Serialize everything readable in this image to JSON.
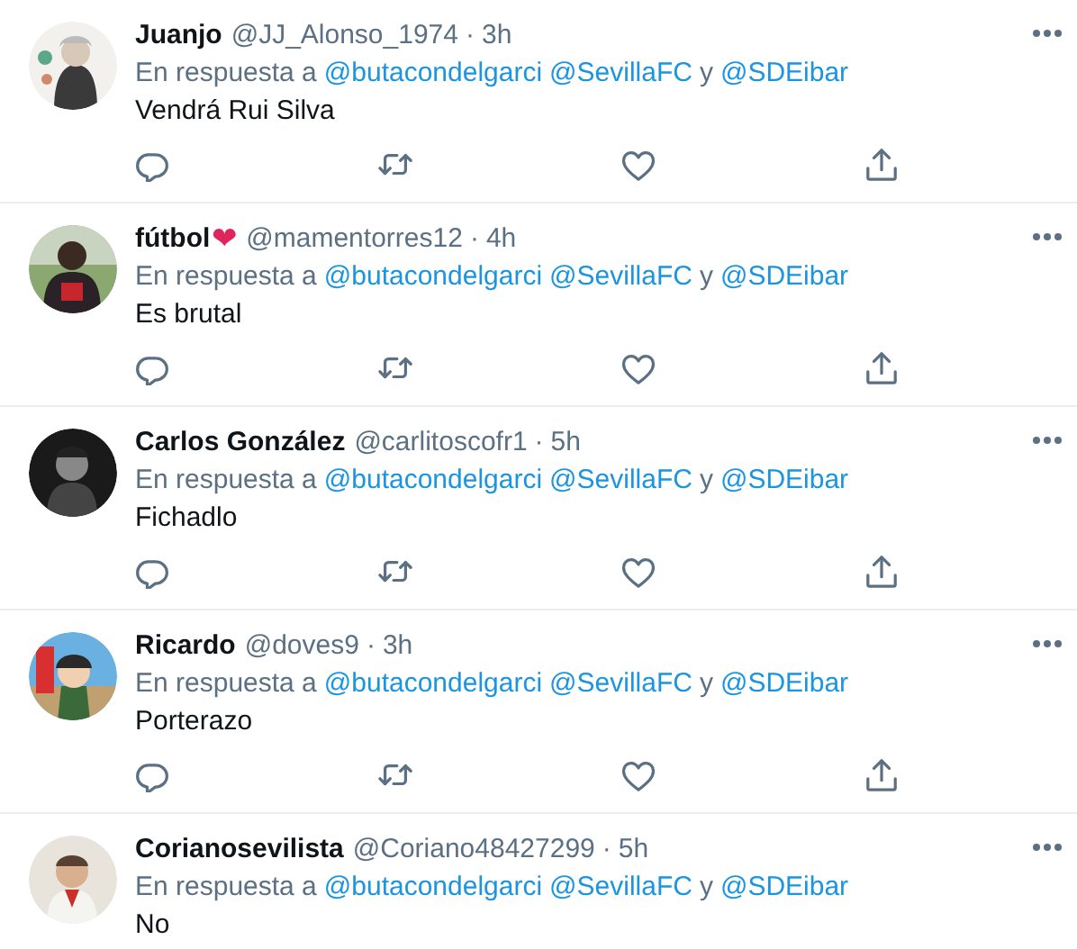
{
  "tweets": [
    {
      "name": "Juanjo",
      "handle": "@JJ_Alonso_1974",
      "separator": "·",
      "time": "3h",
      "reply_prefix": "En respuesta a",
      "mentions": [
        "@butacondelgarci",
        "@SevillaFC",
        "@SDEibar"
      ],
      "conjunction": "y",
      "text": "Vendrá Rui Silva",
      "actions": [
        {
          "kind": "reply"
        },
        {
          "kind": "retweet"
        },
        {
          "kind": "like"
        },
        {
          "kind": "share"
        }
      ]
    },
    {
      "name": "fútbol",
      "name_emoji": "❤",
      "handle": "@mamentorres12",
      "separator": "·",
      "time": "4h",
      "reply_prefix": "En respuesta a",
      "mentions": [
        "@butacondelgarci",
        "@SevillaFC",
        "@SDEibar"
      ],
      "conjunction": "y",
      "text": "Es brutal",
      "actions": [
        {
          "kind": "reply"
        },
        {
          "kind": "retweet"
        },
        {
          "kind": "like"
        },
        {
          "kind": "share"
        }
      ]
    },
    {
      "name": "Carlos González",
      "handle": "@carlitoscofr1",
      "separator": "·",
      "time": "5h",
      "reply_prefix": "En respuesta a",
      "mentions": [
        "@butacondelgarci",
        "@SevillaFC",
        "@SDEibar"
      ],
      "conjunction": "y",
      "text": "Fichadlo",
      "actions": [
        {
          "kind": "reply"
        },
        {
          "kind": "retweet"
        },
        {
          "kind": "like"
        },
        {
          "kind": "share"
        }
      ]
    },
    {
      "name": "Ricardo",
      "handle": "@doves9",
      "separator": "·",
      "time": "3h",
      "reply_prefix": "En respuesta a",
      "mentions": [
        "@butacondelgarci",
        "@SevillaFC",
        "@SDEibar"
      ],
      "conjunction": "y",
      "text": "Porterazo",
      "actions": [
        {
          "kind": "reply"
        },
        {
          "kind": "retweet"
        },
        {
          "kind": "like"
        },
        {
          "kind": "share"
        }
      ]
    },
    {
      "name": "Corianosevilista",
      "handle": "@Coriano48427299",
      "separator": "·",
      "time": "5h",
      "reply_prefix": "En respuesta a",
      "mentions": [
        "@butacondelgarci",
        "@SevillaFC",
        "@SDEibar"
      ],
      "conjunction": "y",
      "text": "No"
    }
  ]
}
